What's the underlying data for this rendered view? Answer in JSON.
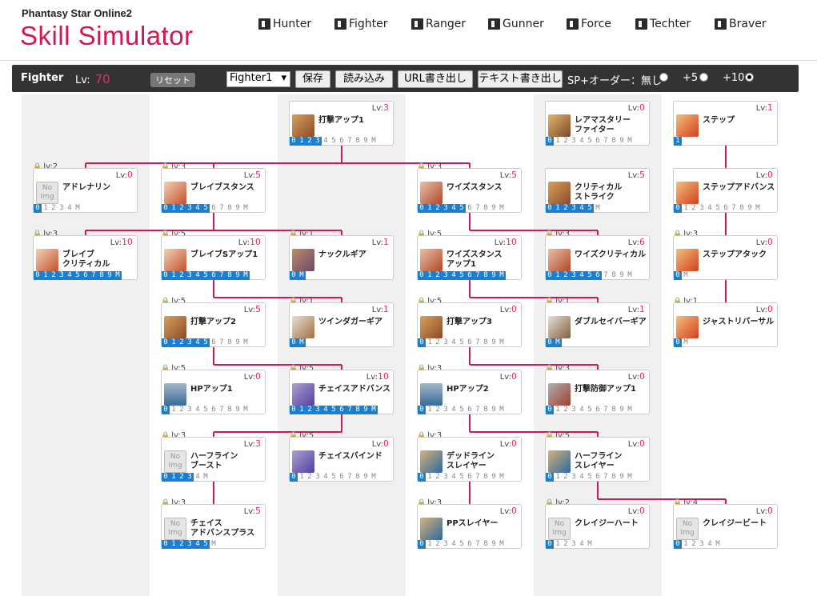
{
  "header": {
    "subtitle": "Phantasy Star Online2",
    "title": "Skill Simulator",
    "classes": [
      {
        "label": "Hunter",
        "icon": "hunter-icon"
      },
      {
        "label": "Fighter",
        "icon": "fighter-icon"
      },
      {
        "label": "Ranger",
        "icon": "ranger-icon"
      },
      {
        "label": "Gunner",
        "icon": "gunner-icon"
      },
      {
        "label": "Force",
        "icon": "force-icon"
      },
      {
        "label": "Techter",
        "icon": "techter-icon"
      },
      {
        "label": "Braver",
        "icon": "braver-icon"
      }
    ]
  },
  "toolbar": {
    "class_name": "Fighter",
    "lv_label": "Lv:",
    "lv_value": "70",
    "reset_label": "リセット",
    "tree_select": "Fighter1",
    "save_label": "保存",
    "load_label": "読み込み",
    "url_export_label": "URL書き出し",
    "text_export_label": "テキスト書き出し",
    "sp_order_label": "SP+オーダー：無し",
    "plus5_label": "+5",
    "plus10_label": "+10",
    "selected_sp_option": "+10"
  },
  "level_label": "Lv:",
  "skills": [
    {
      "id": "daigeki-up1",
      "name": [
        "打撃アップ1"
      ],
      "lv": "3",
      "req": null,
      "icon": "sword-icon",
      "levels": "0123456789M",
      "cur": 3
    },
    {
      "id": "rare-mastery",
      "name": [
        "レアマスタリー",
        "ファイター"
      ],
      "lv": "0",
      "req": null,
      "icon": "star-sword-icon",
      "levels": "0123456789M",
      "cur": 0
    },
    {
      "id": "step",
      "name": [
        "ステップ"
      ],
      "lv": "1",
      "req": null,
      "icon": "step-icon",
      "levels": "1",
      "cur": 0
    },
    {
      "id": "adrenaline",
      "name": [
        "アドレナリン"
      ],
      "lv": "0",
      "req": "lv:2",
      "icon": "noimg",
      "levels": "01234M",
      "cur": 0
    },
    {
      "id": "brave-stance",
      "name": [
        "ブレイブスタンス"
      ],
      "lv": "5",
      "req": "lv:3",
      "icon": "brave-icon",
      "levels": "0123456789M",
      "cur": 5
    },
    {
      "id": "wise-stance",
      "name": [
        "ワイズスタンス"
      ],
      "lv": "5",
      "req": "lv:3",
      "icon": "wise-icon",
      "levels": "0123456789M",
      "cur": 5
    },
    {
      "id": "critical-strike",
      "name": [
        "クリティカル",
        "ストライク"
      ],
      "lv": "5",
      "req": null,
      "icon": "sword-icon",
      "levels": "012345M",
      "cur": 5
    },
    {
      "id": "step-advance",
      "name": [
        "ステップアドバンス"
      ],
      "lv": "0",
      "req": null,
      "icon": "step-icon",
      "levels": "0123456789M",
      "cur": 0
    },
    {
      "id": "brave-critical",
      "name": [
        "ブレイブ",
        "クリティカル"
      ],
      "lv": "10",
      "req": "lv:3",
      "icon": "brave-icon",
      "levels": "0123456789M",
      "cur": 10
    },
    {
      "id": "brave-s-up1",
      "name": [
        "ブレイブSアップ1"
      ],
      "lv": "10",
      "req": "lv:5",
      "icon": "brave-icon",
      "levels": "0123456789M",
      "cur": 10
    },
    {
      "id": "knuckle-gear",
      "name": [
        "ナックルギア"
      ],
      "lv": "1",
      "req": "lv:1",
      "icon": "knuckle-icon",
      "levels": "0M",
      "cur": 1
    },
    {
      "id": "wise-stance-up1",
      "name": [
        "ワイズスタンス",
        "アップ1"
      ],
      "lv": "10",
      "req": "lv:5",
      "icon": "wise-icon",
      "levels": "0123456789M",
      "cur": 10
    },
    {
      "id": "wise-critical",
      "name": [
        "ワイズクリティカル"
      ],
      "lv": "6",
      "req": "lv:3",
      "icon": "wise-icon",
      "levels": "0123456789M",
      "cur": 6
    },
    {
      "id": "step-attack",
      "name": [
        "ステップアタック"
      ],
      "lv": "0",
      "req": "lv:3",
      "icon": "step-icon",
      "levels": "0M",
      "cur": 0
    },
    {
      "id": "daigeki-up2",
      "name": [
        "打撃アップ2"
      ],
      "lv": "5",
      "req": "lv:5",
      "icon": "sword-icon",
      "levels": "0123456789M",
      "cur": 5
    },
    {
      "id": "twin-dagger-gear",
      "name": [
        "ツインダガーギア"
      ],
      "lv": "1",
      "req": "lv:1",
      "icon": "twin-dagger-icon",
      "levels": "0M",
      "cur": 1
    },
    {
      "id": "daigeki-up3",
      "name": [
        "打撃アップ3"
      ],
      "lv": "0",
      "req": "lv:5",
      "icon": "sword-icon",
      "levels": "0123456789M",
      "cur": 0
    },
    {
      "id": "double-saber-gear",
      "name": [
        "ダブルセイバーギア"
      ],
      "lv": "1",
      "req": "lv:1",
      "icon": "double-saber-icon",
      "levels": "0M",
      "cur": 1
    },
    {
      "id": "just-reversal",
      "name": [
        "ジャストリバーサル"
      ],
      "lv": "0",
      "req": "lv:1",
      "icon": "step-icon",
      "levels": "0M",
      "cur": 0
    },
    {
      "id": "hp-up1",
      "name": [
        "HPアップ1"
      ],
      "lv": "0",
      "req": "lv:5",
      "icon": "hp-icon",
      "levels": "0123456789M",
      "cur": 0
    },
    {
      "id": "chase-advance",
      "name": [
        "チェイスアドバンス"
      ],
      "lv": "10",
      "req": "lv:5",
      "icon": "chase-icon",
      "levels": "0123456789M",
      "cur": 10
    },
    {
      "id": "hp-up2",
      "name": [
        "HPアップ2"
      ],
      "lv": "0",
      "req": "lv:3",
      "icon": "hp-icon",
      "levels": "0123456789M",
      "cur": 0
    },
    {
      "id": "daigeki-def-up1",
      "name": [
        "打撃防御アップ1"
      ],
      "lv": "0",
      "req": "lv:3",
      "icon": "def-icon",
      "levels": "0123456789M",
      "cur": 0
    },
    {
      "id": "halfline-boost",
      "name": [
        "ハーフライン",
        "ブースト"
      ],
      "lv": "3",
      "req": "lv:3",
      "icon": "noimg",
      "levels": "01234M",
      "cur": 3
    },
    {
      "id": "chase-bind",
      "name": [
        "チェイスバインド"
      ],
      "lv": "0",
      "req": "lv:5",
      "icon": "chase-icon",
      "levels": "0123456789M",
      "cur": 0
    },
    {
      "id": "deadline-slayer",
      "name": [
        "デッドライン",
        "スレイヤー"
      ],
      "lv": "0",
      "req": "lv:3",
      "icon": "slayer-icon",
      "levels": "0123456789M",
      "cur": 0
    },
    {
      "id": "halfline-slayer",
      "name": [
        "ハーフライン",
        "スレイヤー"
      ],
      "lv": "0",
      "req": "lv:5",
      "icon": "slayer-icon",
      "levels": "0123456789M",
      "cur": 0
    },
    {
      "id": "chase-advance-plus",
      "name": [
        "チェイス",
        "アドバンスプラス"
      ],
      "lv": "5",
      "req": "lv:3",
      "icon": "noimg",
      "levels": "012345M",
      "cur": 5
    },
    {
      "id": "pp-slayer",
      "name": [
        "PPスレイヤー"
      ],
      "lv": "0",
      "req": "lv:3",
      "icon": "slayer-icon",
      "levels": "0123456789M",
      "cur": 0
    },
    {
      "id": "crazy-heart",
      "name": [
        "クレイジーハート"
      ],
      "lv": "0",
      "req": "lv:2",
      "icon": "noimg",
      "levels": "01234M",
      "cur": 0
    },
    {
      "id": "crazy-beat",
      "name": [
        "クレイジービート"
      ],
      "lv": "0",
      "req": "lv:4",
      "icon": "noimg",
      "levels": "01234M",
      "cur": 0
    }
  ],
  "noimg_text": [
    "No",
    "Img"
  ],
  "colors": {
    "accent": "#d5174f",
    "toolbar": "#333333",
    "level_on": "#1a7fd0",
    "connector": "#d2185a"
  }
}
